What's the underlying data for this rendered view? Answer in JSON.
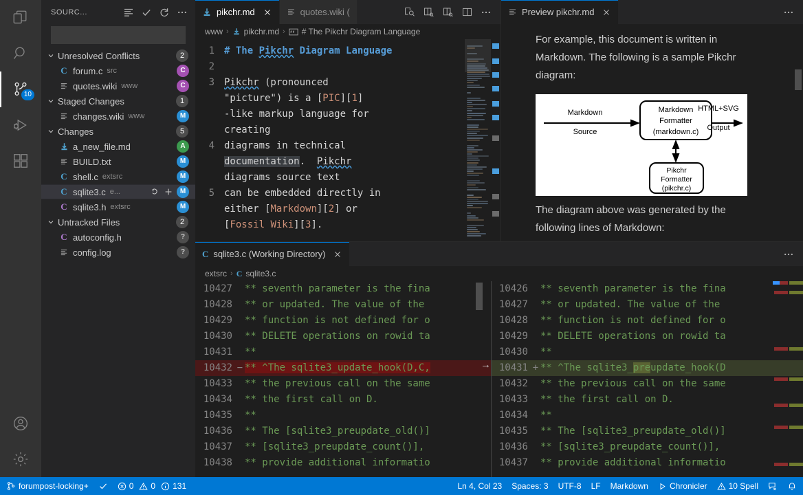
{
  "activitybar": {
    "items": [
      {
        "name": "explorer",
        "icon": "files-icon",
        "active": false
      },
      {
        "name": "search",
        "icon": "search-icon",
        "active": false
      },
      {
        "name": "source-control",
        "icon": "source-control-icon",
        "active": true,
        "badge": "10"
      },
      {
        "name": "run-and-debug",
        "icon": "debug-icon",
        "active": false
      },
      {
        "name": "extensions",
        "icon": "extensions-icon",
        "active": false
      }
    ],
    "bottom": [
      {
        "name": "accounts",
        "icon": "account-icon"
      },
      {
        "name": "manage",
        "icon": "gear-icon"
      }
    ]
  },
  "sidebar": {
    "title": "SOURC...",
    "actions": [
      {
        "name": "view-as-list",
        "icon": "list-icon"
      },
      {
        "name": "commit",
        "icon": "check-icon"
      },
      {
        "name": "refresh",
        "icon": "refresh-icon"
      },
      {
        "name": "more-actions",
        "icon": "ellipsis-icon"
      }
    ],
    "input": {
      "value": "",
      "placeholder": ""
    },
    "groups": [
      {
        "label": "Unresolved Conflicts",
        "count": "2",
        "files": [
          {
            "name": "forum.c",
            "dir": "src",
            "badge": "C",
            "badge_class": "b-C",
            "icon": "c-file-icon",
            "icon_color": "#4fa3d1",
            "selected": false
          },
          {
            "name": "quotes.wiki",
            "dir": "www",
            "badge": "C",
            "badge_class": "b-C",
            "icon": "text-file-icon",
            "icon_color": "#a6a6a6",
            "selected": false
          }
        ]
      },
      {
        "label": "Staged Changes",
        "count": "1",
        "files": [
          {
            "name": "changes.wiki",
            "dir": "www",
            "badge": "M",
            "badge_class": "b-M",
            "icon": "text-file-icon",
            "icon_color": "#a6a6a6",
            "selected": false
          }
        ]
      },
      {
        "label": "Changes",
        "count": "5",
        "files": [
          {
            "name": "a_new_file.md",
            "dir": "",
            "badge": "A",
            "badge_class": "b-A",
            "icon": "markdown-file-icon",
            "icon_color": "#4fa3d1",
            "selected": false
          },
          {
            "name": "BUILD.txt",
            "dir": "",
            "badge": "M",
            "badge_class": "b-M",
            "icon": "text-file-icon",
            "icon_color": "#a6a6a6",
            "selected": false
          },
          {
            "name": "shell.c",
            "dir": "extsrc",
            "badge": "M",
            "badge_class": "b-M",
            "icon": "c-file-icon",
            "icon_color": "#4fa3d1",
            "selected": false
          },
          {
            "name": "sqlite3.c",
            "dir": "e...",
            "badge": "M",
            "badge_class": "b-M",
            "icon": "c-file-icon",
            "icon_color": "#4fa3d1",
            "selected": true,
            "actions": [
              {
                "name": "discard-changes-button",
                "icon": "undo-icon"
              },
              {
                "name": "stage-changes-button",
                "icon": "plus-icon"
              }
            ]
          },
          {
            "name": "sqlite3.h",
            "dir": "extsrc",
            "badge": "M",
            "badge_class": "b-M",
            "icon": "h-file-icon",
            "icon_color": "#b07bd0",
            "selected": false
          }
        ]
      },
      {
        "label": "Untracked Files",
        "count": "2",
        "files": [
          {
            "name": "autoconfig.h",
            "dir": "",
            "badge": "?",
            "badge_class": "b-Q",
            "icon": "h-file-icon",
            "icon_color": "#b07bd0",
            "selected": false
          },
          {
            "name": "config.log",
            "dir": "",
            "badge": "?",
            "badge_class": "b-Q",
            "icon": "text-file-icon",
            "icon_color": "#a6a6a6",
            "selected": false
          }
        ]
      }
    ]
  },
  "editor_group_left": {
    "tabs": [
      {
        "label": "pikchr.md",
        "icon": "markdown-file-icon",
        "active": true,
        "dirty": false,
        "closeable": true
      },
      {
        "label": "quotes.wiki (",
        "icon": "text-file-icon",
        "active": false,
        "dirty": false,
        "closeable": false
      }
    ],
    "actions": [
      {
        "name": "open-preview-to-the-side-button",
        "icon": "preview-icon"
      },
      {
        "name": "split-editor-right-button",
        "icon": "split-right-icon"
      },
      {
        "name": "split-editor-down-button",
        "icon": "split-down-icon"
      },
      {
        "name": "toggle-layout-button",
        "icon": "layout-icon"
      },
      {
        "name": "more-editor-actions-button",
        "icon": "ellipsis-icon"
      }
    ],
    "breadcrumb": [
      "www",
      "pikchr.md",
      "# The Pikchr Diagram Language"
    ],
    "code": [
      {
        "line": "1",
        "segments": [
          {
            "t": "# The ",
            "c": "c-head"
          },
          {
            "t": "Pikchr",
            "c": "c-head squiggle"
          },
          {
            "t": " Diagram Language",
            "c": "c-head"
          }
        ]
      },
      {
        "line": "2",
        "segments": []
      },
      {
        "line": "3",
        "segments": [
          {
            "t": "Pikchr",
            "c": "c-plain squiggle"
          },
          {
            "t": " (pronounced\n\"picture\") is a [",
            "c": "c-plain"
          },
          {
            "t": "PIC",
            "c": "c-str"
          },
          {
            "t": "][",
            "c": "c-plain"
          },
          {
            "t": "1",
            "c": "c-str"
          },
          {
            "t": "]\n-like markup language for\ncreating",
            "c": "c-plain"
          }
        ]
      },
      {
        "line": "4",
        "segments": [
          {
            "t": "diagrams in technical\n",
            "c": "c-plain"
          },
          {
            "t": "documentation",
            "c": "c-plain sel"
          },
          {
            "t": ".  ",
            "c": "c-plain"
          },
          {
            "t": "Pikchr",
            "c": "c-plain squiggle"
          },
          {
            "t": "\ndiagrams source text",
            "c": "c-plain"
          }
        ]
      },
      {
        "line": "5",
        "segments": [
          {
            "t": "can be embedded directly in\neither [",
            "c": "c-plain"
          },
          {
            "t": "Markdown",
            "c": "c-str"
          },
          {
            "t": "][",
            "c": "c-plain"
          },
          {
            "t": "2",
            "c": "c-str"
          },
          {
            "t": "] or\n[",
            "c": "c-plain"
          },
          {
            "t": "Fossil Wiki",
            "c": "c-str"
          },
          {
            "t": "][",
            "c": "c-plain"
          },
          {
            "t": "3",
            "c": "c-str"
          },
          {
            "t": "].",
            "c": "c-plain"
          }
        ]
      }
    ]
  },
  "preview_group": {
    "tab": {
      "label": "Preview pikchr.md",
      "icon": "preview-file-icon"
    },
    "actions": [
      {
        "name": "more-preview-actions-button",
        "icon": "ellipsis-icon"
      }
    ],
    "paragraph_1": "For example, this document is written in Markdown. The following is a sample Pikchr diagram:",
    "paragraph_2": "The diagram above was generated by the following lines of Markdown:",
    "diagram": {
      "nodes": [
        {
          "id": "markdown-formatter",
          "lines": [
            "Markdown",
            "Formatter",
            "(markdown.c)"
          ]
        },
        {
          "id": "pikchr-formatter",
          "lines": [
            "Pikchr",
            "Formatter",
            "(pikchr.c)"
          ]
        }
      ],
      "labels": [
        {
          "id": "input-label",
          "lines": [
            "Markdown",
            "Source"
          ]
        },
        {
          "id": "output-label",
          "lines": [
            "HTML+SVG",
            "Output"
          ]
        }
      ]
    }
  },
  "diff_editor": {
    "tab": {
      "label": "sqlite3.c (Working Directory)",
      "icon": "c-file-icon"
    },
    "actions": [
      {
        "name": "more-diff-actions-button",
        "icon": "ellipsis-icon"
      }
    ],
    "breadcrumb": [
      "extsrc",
      "sqlite3.c"
    ],
    "left": [
      {
        "num": "10427",
        "sign": "",
        "type": "ctx",
        "text": "** seventh parameter is the fina"
      },
      {
        "num": "10428",
        "sign": "",
        "type": "ctx",
        "text": "** or updated. The value of the"
      },
      {
        "num": "10429",
        "sign": "",
        "type": "ctx",
        "text": "** function is not defined for o"
      },
      {
        "num": "10430",
        "sign": "",
        "type": "ctx",
        "text": "** DELETE operations on rowid ta"
      },
      {
        "num": "10431",
        "sign": "",
        "type": "ctx",
        "text": "**"
      },
      {
        "num": "10432",
        "sign": "−",
        "type": "del",
        "text": "** ^The sqlite3_update_hook(D,C,"
      },
      {
        "num": "10433",
        "sign": "",
        "type": "ctx",
        "text": "** the previous call on the same"
      },
      {
        "num": "10434",
        "sign": "",
        "type": "ctx",
        "text": "** the first call on D."
      },
      {
        "num": "10435",
        "sign": "",
        "type": "ctx",
        "text": "**"
      },
      {
        "num": "10436",
        "sign": "",
        "type": "ctx",
        "text": "** The [sqlite3_preupdate_old()]"
      },
      {
        "num": "10437",
        "sign": "",
        "type": "ctx",
        "text": "** [sqlite3_preupdate_count()],"
      },
      {
        "num": "10438",
        "sign": "",
        "type": "ctx",
        "text": "** provide additional informatio"
      }
    ],
    "right": [
      {
        "num": "10426",
        "sign": "",
        "type": "ctx",
        "text": "** seventh parameter is the fina"
      },
      {
        "num": "10427",
        "sign": "",
        "type": "ctx",
        "text": "** or updated. The value of the"
      },
      {
        "num": "10428",
        "sign": "",
        "type": "ctx",
        "text": "** function is not defined for o"
      },
      {
        "num": "10429",
        "sign": "",
        "type": "ctx",
        "text": "** DELETE operations on rowid ta"
      },
      {
        "num": "10430",
        "sign": "",
        "type": "ctx",
        "text": "**"
      },
      {
        "num": "10431",
        "sign": "+",
        "type": "add",
        "text": "** ^The sqlite3_preupdate_hook(D"
      },
      {
        "num": "10432",
        "sign": "",
        "type": "ctx",
        "text": "** the previous call on the same"
      },
      {
        "num": "10433",
        "sign": "",
        "type": "ctx",
        "text": "** the first call on D."
      },
      {
        "num": "10434",
        "sign": "",
        "type": "ctx",
        "text": "**"
      },
      {
        "num": "10435",
        "sign": "",
        "type": "ctx",
        "text": "** The [sqlite3_preupdate_old()]"
      },
      {
        "num": "10436",
        "sign": "",
        "type": "ctx",
        "text": "** [sqlite3_preupdate_count()],"
      },
      {
        "num": "10437",
        "sign": "",
        "type": "ctx",
        "text": "** provide additional informatio"
      }
    ]
  },
  "statusbar": {
    "branch": "forumpost-locking+",
    "sync_icon": "check-icon",
    "errors": "0",
    "warnings": "0",
    "infos": "131",
    "position": "Ln 4, Col 23",
    "indent": "Spaces: 3",
    "encoding": "UTF-8",
    "eol": "LF",
    "language": "Markdown",
    "chronicler": "Chronicler",
    "spell": "10 Spell",
    "feedback_icon": "feedback-icon",
    "bell_icon": "bell-icon",
    "accent": "#0078d4"
  }
}
